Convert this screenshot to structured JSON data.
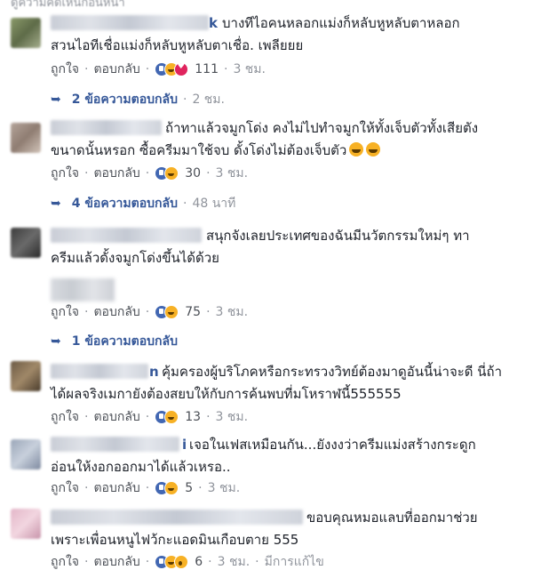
{
  "top_cut_text": "ดูความคิดเห็นก่อนหน้า",
  "comments": [
    {
      "name_tail": "k",
      "lines": [
        "บางทีไอคนหลอกแม่งก็หลับหูหลับตาหลอก",
        "สวนไอทีเชื่อแม่งก็หลับหูหลับตาเชื่อ. เพลียยย"
      ],
      "like": "ถูกใจ",
      "reply": "ตอบกลับ",
      "reactions": [
        "like-reaction",
        "haha-reaction",
        "heart-reaction"
      ],
      "count": "111",
      "time": "3 ชม.",
      "replies_label": "2 ข้อความตอบกลับ",
      "replies_time": "2 ชม."
    },
    {
      "name_tail": "",
      "lines": [
        "ถ้าทาแล้วจมูกโด่ง คงไม่ไปทำจมูกให้ทั้งเจ็บตัวทั้งเสียตัง",
        "ขนาดนั้นหรอก ซื้อครีมมาใช้จบ ดั้งโด่งไม่ต้องเจ็บตัว"
      ],
      "like": "ถูกใจ",
      "reply": "ตอบกลับ",
      "reactions": [
        "like-reaction",
        "haha-reaction"
      ],
      "count": "30",
      "time": "3 ชม.",
      "replies_label": "4 ข้อความตอบกลับ",
      "replies_time": "48 นาที"
    },
    {
      "name_tail": "",
      "lines": [
        "สนุกจังเลยประเทศของฉันมีนวัตกรรมใหม่ๆ ทา",
        "ครีมแล้วดั้งจมูกโด่งขึ้นได้ด้วย"
      ],
      "like": "ถูกใจ",
      "reply": "ตอบกลับ",
      "reactions": [
        "like-reaction",
        "haha-reaction"
      ],
      "count": "75",
      "time": "3 ชม.",
      "replies_label": "1 ข้อความตอบกลับ",
      "replies_time": ""
    },
    {
      "name_tail": "n",
      "lines": [
        "คุ้มครองผู้บริโภคหรือกระทรวงวิทย์ต้องมาดูอันนี้น่าจะดี นี่ถ้า",
        "ได้ผลจริงเมกายังต้องสยบให้กับการค้นพบที่มโหราฬนี้555555"
      ],
      "like": "ถูกใจ",
      "reply": "ตอบกลับ",
      "reactions": [
        "like-reaction",
        "haha-reaction"
      ],
      "count": "13",
      "time": "3 ชม."
    },
    {
      "name_tail": "i",
      "lines": [
        "เจอในเฟสเหมือนกัน...ยังงงว่าครีมแม่งสร้างกระดูก",
        "อ่อนให้งอกออกมาได้แล้วเหรอ.."
      ],
      "like": "ถูกใจ",
      "reply": "ตอบกลับ",
      "reactions": [
        "like-reaction",
        "haha-reaction"
      ],
      "count": "5",
      "time": "3 ชม."
    },
    {
      "name_tail": "",
      "lines": [
        "ขอบคุณหมอแลบที่ออกมาช่วย",
        "เพราะเพื่อนหนูไฟว้กะแอดมินเกือบตาย 555"
      ],
      "like": "ถูกใจ",
      "reply": "ตอบกลับ",
      "reactions": [
        "like-reaction",
        "haha-reaction",
        "wow-reaction"
      ],
      "count": "6",
      "time": "3 ชม.",
      "edited": "มีการแก้ไข"
    }
  ]
}
